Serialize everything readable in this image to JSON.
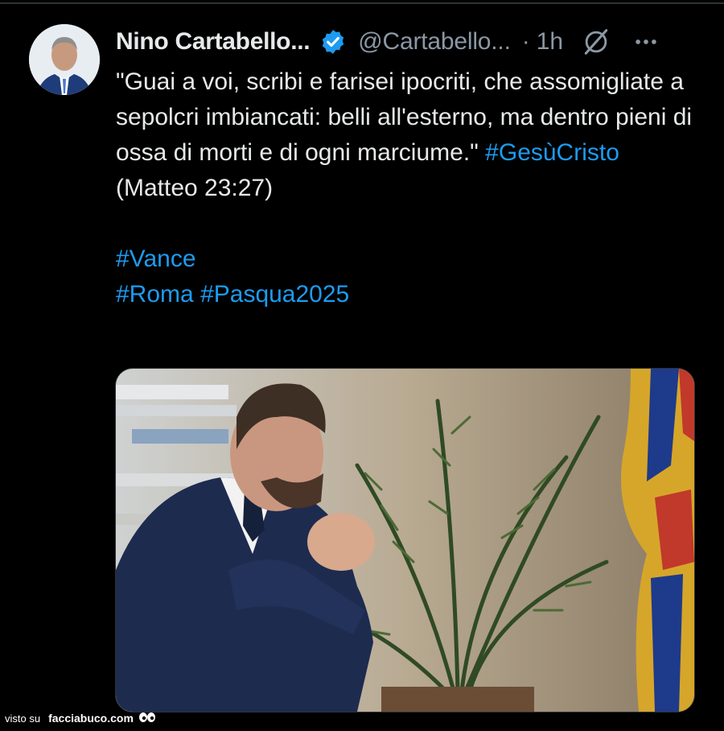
{
  "tweet": {
    "author_name": "Nino Cartabello...",
    "handle": "@Cartabello...",
    "separator": "·",
    "time": "1h",
    "icons": {
      "verified": "verified-badge-icon",
      "grok": "grok-icon",
      "more": "more-options-icon"
    },
    "text": {
      "quote": "\"Guai a voi, scribi e farisei ipocriti, che assomigliate a sepolcri imbiancati: belli all'esterno, ma dentro pieni di ossa di morti e di ogni marciume.\"",
      "hashtag1": "#GesùCristo",
      "reference": "(Matteo 23:27)",
      "hashtag2": "#Vance",
      "hashtag3": "#Roma",
      "hashtag4": "#Pasqua2025"
    },
    "media": {
      "description_icon": "photo"
    }
  },
  "colors": {
    "background": "#000000",
    "text": "#e7e9ea",
    "muted": "#8b98a5",
    "accent": "#1d9bf0"
  },
  "watermark": {
    "prefix": "visto su",
    "brand": "facciabuco.com"
  }
}
